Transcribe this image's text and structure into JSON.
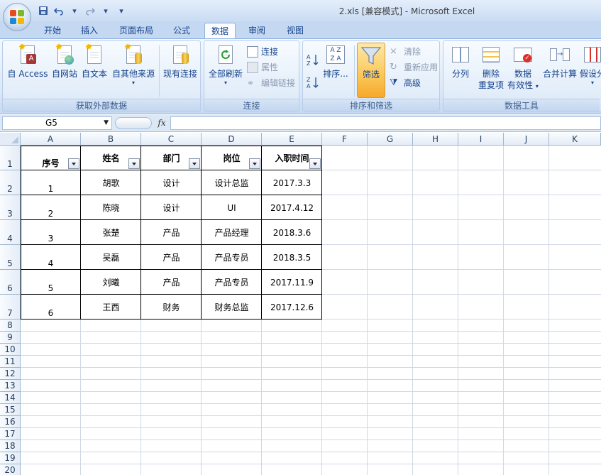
{
  "window": {
    "title": "2.xls  [兼容模式] - Microsoft Excel"
  },
  "tabs": [
    {
      "label": "开始",
      "active": false
    },
    {
      "label": "插入",
      "active": false
    },
    {
      "label": "页面布局",
      "active": false
    },
    {
      "label": "公式",
      "active": false
    },
    {
      "label": "数据",
      "active": true
    },
    {
      "label": "审阅",
      "active": false
    },
    {
      "label": "视图",
      "active": false
    }
  ],
  "ribbon": {
    "external": {
      "label": "获取外部数据",
      "access": "自 Access",
      "web": "自网站",
      "text": "自文本",
      "other": "自其他来源",
      "existing": "现有连接"
    },
    "connections": {
      "label": "连接",
      "refresh_all": "全部刷新",
      "connections": "连接",
      "properties": "属性",
      "edit_links": "编辑链接"
    },
    "sort_filter": {
      "label": "排序和筛选",
      "sort": "排序...",
      "filter": "筛选",
      "clear": "清除",
      "reapply": "重新应用",
      "advanced": "高级"
    },
    "data_tools": {
      "label": "数据工具",
      "text_to_columns": "分列",
      "remove_dup_1": "删除",
      "remove_dup_2": "重复项",
      "validation_1": "数据",
      "validation_2": "有效性",
      "consolidate": "合并计算",
      "what_if": "假设分"
    }
  },
  "formula_bar": {
    "name_box": "G5",
    "fx": "fx",
    "value": ""
  },
  "columns": [
    "A",
    "B",
    "C",
    "D",
    "E",
    "F",
    "G",
    "H",
    "I",
    "J",
    "K"
  ],
  "rows": [
    "1",
    "2",
    "3",
    "4",
    "5",
    "6",
    "7",
    "8",
    "9",
    "10",
    "11",
    "12",
    "13",
    "14",
    "15",
    "16",
    "17",
    "18",
    "19",
    "20"
  ],
  "table": {
    "headers": [
      "序号",
      "姓名",
      "部门",
      "岗位",
      "入职时间"
    ],
    "rows": [
      [
        "1",
        "胡歌",
        "设计",
        "设计总监",
        "2017.3.3"
      ],
      [
        "2",
        "陈晓",
        "设计",
        "UI",
        "2017.4.12"
      ],
      [
        "3",
        "张楚",
        "产品",
        "产品经理",
        "2018.3.6"
      ],
      [
        "4",
        "吴磊",
        "产品",
        "产品专员",
        "2018.3.5"
      ],
      [
        "5",
        "刘曦",
        "产品",
        "产品专员",
        "2017.11.9"
      ],
      [
        "6",
        "王西",
        "财务",
        "财务总监",
        "2017.12.6"
      ]
    ]
  }
}
